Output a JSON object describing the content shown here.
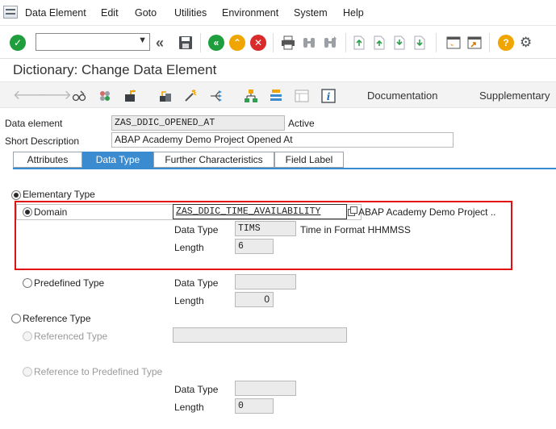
{
  "menu": {
    "items": [
      "Data Element",
      "Edit",
      "Goto",
      "Utilities",
      "Environment",
      "System",
      "Help"
    ]
  },
  "toolbar": {
    "command_field_value": "",
    "icons": [
      "enter-icon",
      "command-dropdown-icon",
      "fast-rewind-icon",
      "save-icon",
      "back-icon",
      "exit-icon",
      "cancel-icon",
      "print-icon",
      "find-icon",
      "find-next-icon",
      "first-page-icon",
      "previous-page-icon",
      "next-page-icon",
      "last-page-icon",
      "create-session-icon",
      "create-shortcut-icon",
      "help-icon",
      "settings-icon"
    ]
  },
  "title": "Dictionary: Change Data Element",
  "app_toolbar": {
    "icons": [
      "back-arrow-icon",
      "forward-arrow-icon",
      "display-change-icon",
      "other-object-icon",
      "check-icon",
      "activate-icon",
      "test-icon",
      "where-used-icon",
      "hierarchy-icon",
      "object-list-icon",
      "display-object-list-icon",
      "info-icon"
    ],
    "documentation_label": "Documentation",
    "supplementary_label": "Supplementary"
  },
  "header": {
    "data_element_label": "Data element",
    "data_element_value": "ZAS_DDIC_OPENED_AT",
    "status": "Active",
    "short_description_label": "Short Description",
    "short_description_value": "ABAP Academy Demo Project Opened At"
  },
  "tabs": [
    {
      "label": "Attributes",
      "active": false
    },
    {
      "label": "Data Type",
      "active": true
    },
    {
      "label": "Further Characteristics",
      "active": false
    },
    {
      "label": "Field Label",
      "active": false
    }
  ],
  "data_type_tab": {
    "elementary_type_label": "Elementary Type",
    "domain_label": "Domain",
    "domain_value": "ZAS_DDIC_TIME_AVAILABILITY",
    "domain_description": "ABAP Academy Demo Project ...",
    "domain_data_type_label": "Data Type",
    "domain_data_type_value": "TIMS",
    "domain_data_type_description": "Time in Format HHMMSS",
    "domain_length_label": "Length",
    "domain_length_value": "6",
    "predefined_type_label": "Predefined Type",
    "predefined_data_type_label": "Data Type",
    "predefined_data_type_value": "",
    "predefined_length_label": "Length",
    "predefined_length_value": "0",
    "reference_type_label": "Reference Type",
    "referenced_type_label": "Referenced Type",
    "referenced_type_value": "",
    "ref_predefined_type_label": "Reference to Predefined Type",
    "ref_predefined_data_type_label": "Data Type",
    "ref_predefined_data_type_value": "",
    "ref_predefined_length_label": "Length",
    "ref_predefined_length_value": "0"
  },
  "colors": {
    "accent": "#3b8bd0",
    "highlight_border": "#e01010",
    "enter_green": "#1e9e3c",
    "back_green": "#1e9e3c",
    "exit_orange": "#f0a500",
    "cancel_red": "#d92b2b",
    "help_orange": "#f0a500"
  }
}
